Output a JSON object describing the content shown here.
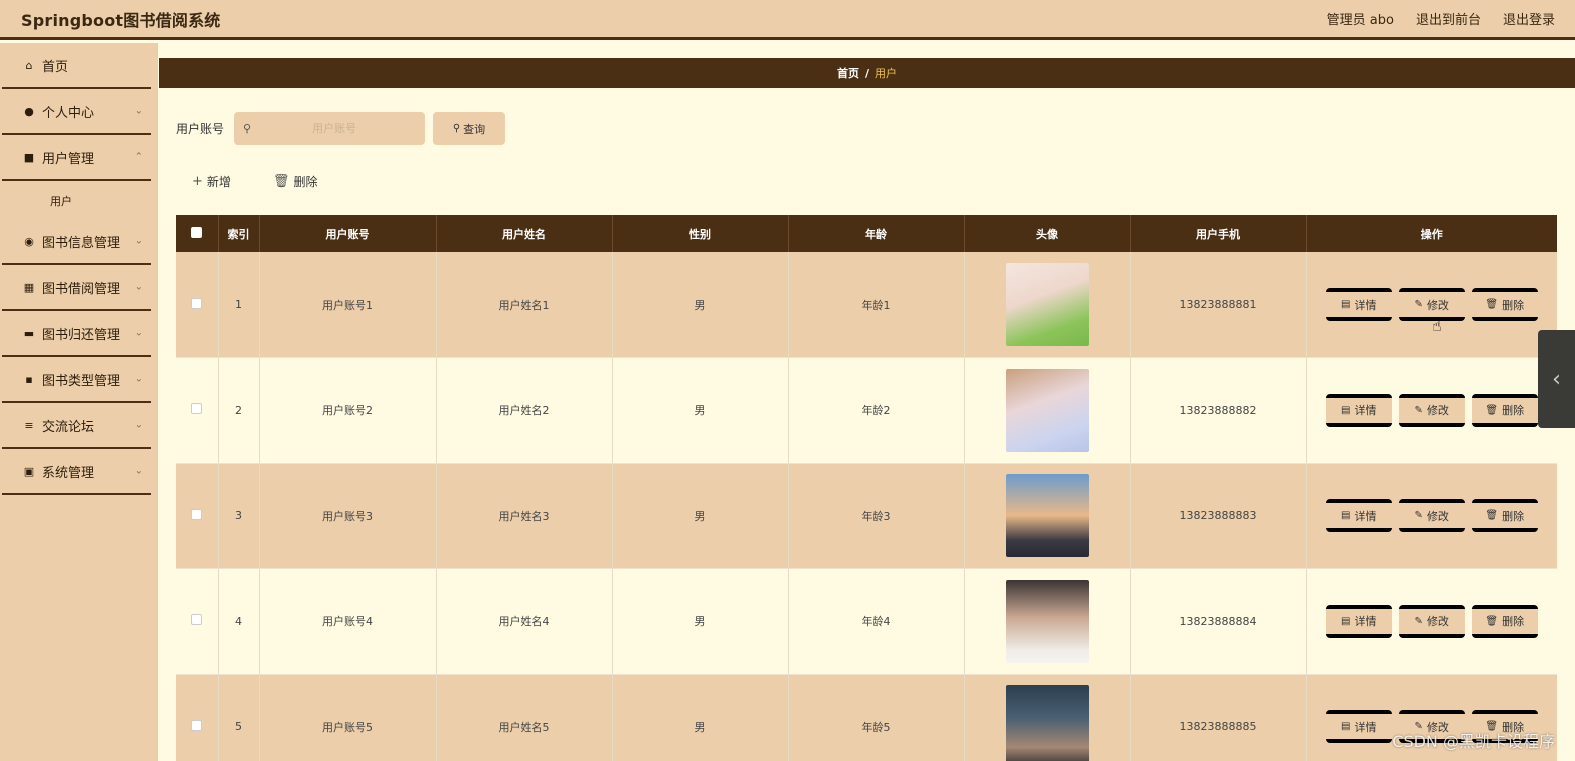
{
  "header": {
    "title": "Springboot图书借阅系统",
    "admin_label": "管理员 abo",
    "front_label": "退出到前台",
    "logout_label": "退出登录"
  },
  "sidebar": {
    "items": [
      {
        "label": "首页",
        "icon": "home-icon",
        "glyph": "⌂",
        "has_chevron": false
      },
      {
        "label": "个人中心",
        "icon": "user-icon",
        "glyph": "●",
        "has_chevron": true
      },
      {
        "label": "用户管理",
        "icon": "monitor-icon",
        "glyph": "■",
        "has_chevron": true
      },
      {
        "label": "图书信息管理",
        "icon": "bulb-icon",
        "glyph": "◉",
        "has_chevron": true
      },
      {
        "label": "图书借阅管理",
        "icon": "grid-icon",
        "glyph": "▦",
        "has_chevron": true
      },
      {
        "label": "图书归还管理",
        "icon": "box-icon",
        "glyph": "▬",
        "has_chevron": true
      },
      {
        "label": "图书类型管理",
        "icon": "apps-icon",
        "glyph": "▪",
        "has_chevron": true
      },
      {
        "label": "交流论坛",
        "icon": "list-icon",
        "glyph": "≡",
        "has_chevron": true
      },
      {
        "label": "系统管理",
        "icon": "clipboard-icon",
        "glyph": "▣",
        "has_chevron": true
      }
    ],
    "sub_item": "用户"
  },
  "breadcrumb": {
    "home": "首页",
    "separator": "/",
    "current": "用户"
  },
  "search": {
    "label": "用户账号",
    "placeholder": "用户账号",
    "value": "",
    "button": "查询"
  },
  "actions": {
    "add": "新增",
    "delete": "删除"
  },
  "table": {
    "columns": [
      "索引",
      "用户账号",
      "用户姓名",
      "性别",
      "年龄",
      "头像",
      "用户手机",
      "操作"
    ],
    "rows": [
      {
        "index": "1",
        "account": "用户账号1",
        "name": "用户姓名1",
        "gender": "男",
        "age": "年龄1",
        "phone": "13823888881"
      },
      {
        "index": "2",
        "account": "用户账号2",
        "name": "用户姓名2",
        "gender": "男",
        "age": "年龄2",
        "phone": "13823888882"
      },
      {
        "index": "3",
        "account": "用户账号3",
        "name": "用户姓名3",
        "gender": "男",
        "age": "年龄3",
        "phone": "13823888883"
      },
      {
        "index": "4",
        "account": "用户账号4",
        "name": "用户姓名4",
        "gender": "男",
        "age": "年龄4",
        "phone": "13823888884"
      },
      {
        "index": "5",
        "account": "用户账号5",
        "name": "用户姓名5",
        "gender": "男",
        "age": "年龄5",
        "phone": "13823888885"
      }
    ],
    "row_actions": {
      "detail": "详情",
      "edit": "修改",
      "delete": "删除"
    }
  },
  "watermark": "CSDN @黑凯卡设程序",
  "colors": {
    "header_bg": "#ecceaa",
    "accent_dark": "#4a2f15",
    "page_bg": "#fefbe2",
    "breadcrumb_current": "#f0c050"
  }
}
